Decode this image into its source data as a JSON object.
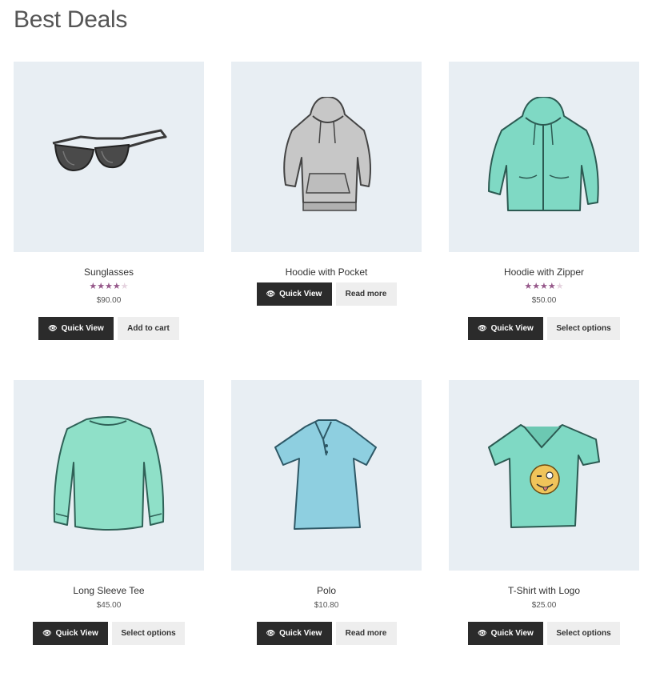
{
  "page": {
    "title": "Best Deals"
  },
  "products": [
    {
      "name": "Sunglasses",
      "rating": 4,
      "price": "$90.00",
      "quick_view": "Quick View",
      "action": "Add to cart",
      "image": "sunglasses-image",
      "color": "#6f6f6f"
    },
    {
      "name": "Hoodie with Pocket",
      "rating": 0,
      "price": "",
      "quick_view": "Quick View",
      "action": "Read more",
      "image": "hoodie-pocket-image",
      "color": "#bdbdbd"
    },
    {
      "name": "Hoodie with Zipper",
      "rating": 4,
      "price": "$50.00",
      "quick_view": "Quick View",
      "action": "Select options",
      "image": "hoodie-zipper-image",
      "color": "#7fd9c4"
    },
    {
      "name": "Long Sleeve Tee",
      "rating": 0,
      "price": "$45.00",
      "quick_view": "Quick View",
      "action": "Select options",
      "image": "long-sleeve-tee-image",
      "color": "#8fe0c8"
    },
    {
      "name": "Polo",
      "rating": 0,
      "price": "$10.80",
      "quick_view": "Quick View",
      "action": "Read more",
      "image": "polo-image",
      "color": "#8ecfe0"
    },
    {
      "name": "T-Shirt with Logo",
      "rating": 0,
      "price": "$25.00",
      "quick_view": "Quick View",
      "action": "Select options",
      "image": "tshirt-logo-image",
      "color": "#7fd9c4"
    }
  ],
  "colors": {
    "accent_star": "#96588a",
    "button_dark": "#2b2b2b",
    "button_light": "#eeeeee",
    "thumb_bg": "#e8eef3"
  }
}
